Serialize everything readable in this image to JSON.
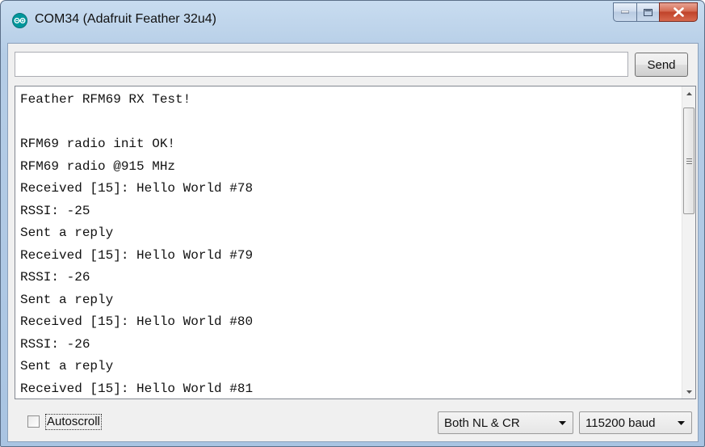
{
  "window": {
    "title": "COM34 (Adafruit Feather 32u4)"
  },
  "input": {
    "value": "",
    "send_label": "Send"
  },
  "output": {
    "lines": [
      "Feather RFM69 RX Test!",
      "",
      "RFM69 radio init OK!",
      "RFM69 radio @915 MHz",
      "Received [15]: Hello World #78",
      "RSSI: -25",
      "Sent a reply",
      "Received [15]: Hello World #79",
      "RSSI: -26",
      "Sent a reply",
      "Received [15]: Hello World #80",
      "RSSI: -26",
      "Sent a reply",
      "Received [15]: Hello World #81"
    ]
  },
  "footer": {
    "autoscroll_label": "Autoscroll",
    "autoscroll_checked": false,
    "line_ending": "Both NL & CR",
    "baud_rate": "115200 baud"
  },
  "colors": {
    "arduino_teal": "#00979c",
    "close_red": "#c0432a"
  }
}
